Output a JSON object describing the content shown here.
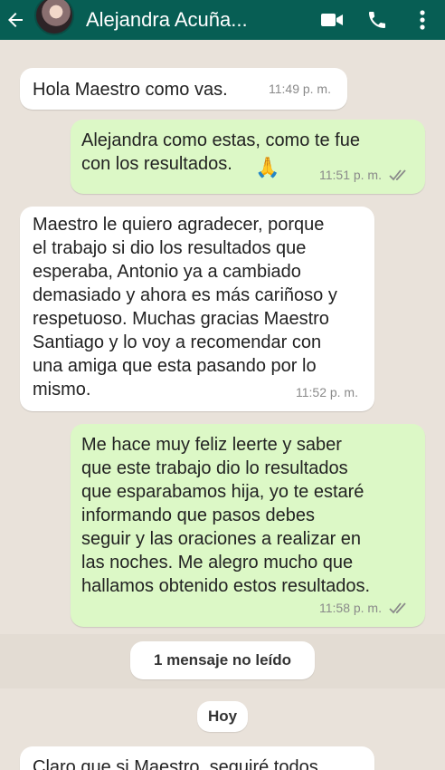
{
  "header": {
    "contact_name": "Alejandra Acuña...",
    "icons": [
      "back-arrow-icon",
      "avatar",
      "video-call-icon",
      "phone-icon",
      "more-options-icon"
    ]
  },
  "messages": [
    {
      "direction": "incoming",
      "text": "Hola Maestro como vas.",
      "time": "11:49 p. m."
    },
    {
      "direction": "outgoing",
      "text": "Alejandra como estas, como te fue\ncon los resultados.",
      "emoji": "🙏",
      "time": "11:51 p. m.",
      "status": "read"
    },
    {
      "direction": "incoming",
      "text": "Maestro le quiero agradecer, porque\nel trabajo si dio los resultados que\nesperaba, Antonio ya a cambiado\ndemasiado y ahora es más cariñoso y\nrespetuoso. Muchas gracias Maestro\nSantiago y lo voy a recomendar con\nuna amiga que esta pasando por lo\nmismo.",
      "time": "11:52 p. m."
    },
    {
      "direction": "outgoing",
      "text": "Me hace muy feliz leerte y saber\nque este trabajo dio lo resultados\nque esparabamos hija, yo te estaré\ninformando que pasos debes\nseguir y las oraciones a realizar en\nlas noches. Me alegro mucho que\nhallamos obtenido estos resultados.",
      "time": "11:58 p. m.",
      "status": "read"
    },
    {
      "direction": "incoming",
      "text": "Claro que si Maestro, seguiré todos"
    }
  ],
  "unread_label": "1 mensaje no leído",
  "date_label": "Hoy",
  "colors": {
    "header": "#075e54",
    "outgoing_bubble": "#dcf8c6",
    "incoming_bubble": "#ffffff",
    "wallpaper": "#e9e2da",
    "read_ticks": "#8a8a8a"
  }
}
